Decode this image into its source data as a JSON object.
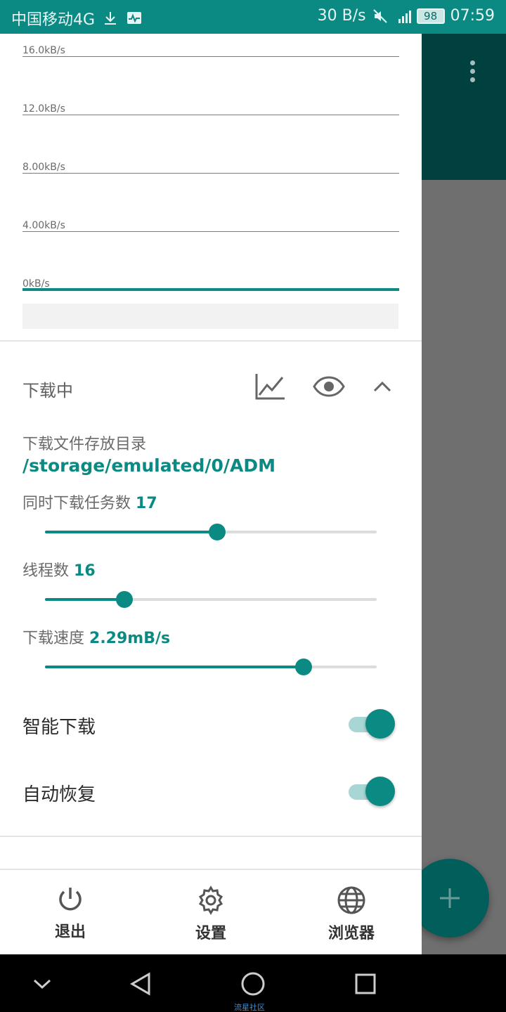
{
  "status_bar": {
    "carrier": "中国移动4G",
    "net_speed": "30 B/s",
    "battery": "98",
    "time": "07:59",
    "icons": [
      "download-icon",
      "monitor-icon",
      "mute-icon",
      "signal-icon"
    ]
  },
  "chart_data": {
    "type": "line",
    "title": "",
    "y_tick_labels": [
      "16.0kB/s",
      "12.0kB/s",
      "8.00kB/s",
      "4.00kB/s",
      "0kB/s"
    ],
    "ylim": [
      0,
      16
    ],
    "series": [
      {
        "values": [
          0,
          0
        ]
      }
    ],
    "grid": true,
    "color": "#0e8a85"
  },
  "section": {
    "title": "下载中",
    "icons": [
      "chart-icon",
      "eye-icon",
      "chevron-up-icon"
    ]
  },
  "settings": {
    "dir_label": "下载文件存放目录",
    "dir_path": "/storage/emulated/0/ADM",
    "tasks_label": "同时下载任务数",
    "tasks_value": "17",
    "threads_label": "线程数",
    "threads_value": "16",
    "speed_label": "下载速度",
    "speed_value": "2.29mB/s",
    "sliders": {
      "tasks": 0.52,
      "threads": 0.24,
      "speed": 0.78
    }
  },
  "toggles": {
    "smart": {
      "label": "智能下载",
      "on": true
    },
    "resume": {
      "label": "自动恢复",
      "on": true
    }
  },
  "bottom_nav": {
    "exit": "退出",
    "settings": "设置",
    "browser": "浏览器"
  },
  "watermark": "流星社区",
  "colors": {
    "accent": "#0b8a84",
    "status_bar": "#0b8a84",
    "dark_appbar": "#00413f"
  }
}
